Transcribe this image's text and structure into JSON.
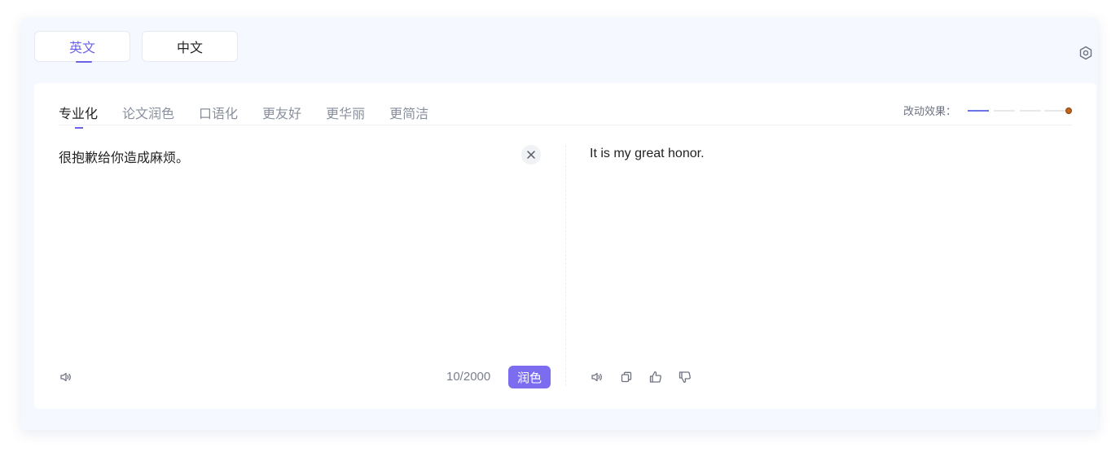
{
  "lang_tabs": [
    {
      "label": "英文",
      "active": true
    },
    {
      "label": "中文",
      "active": false
    }
  ],
  "icons": {
    "settings": "gear-icon",
    "clear": "close-icon",
    "speaker": "speaker-icon",
    "copy": "copy-icon",
    "like": "thumbs-up-icon",
    "dislike": "thumbs-down-icon"
  },
  "style_tabs": [
    {
      "label": "专业化",
      "active": true
    },
    {
      "label": "论文润色",
      "active": false
    },
    {
      "label": "口语化",
      "active": false
    },
    {
      "label": "更友好",
      "active": false
    },
    {
      "label": "更华丽",
      "active": false
    },
    {
      "label": "更简洁",
      "active": false
    }
  ],
  "effect": {
    "label": "改动效果：",
    "level": 1.0
  },
  "source": {
    "text": "很抱歉给你造成麻烦。",
    "counter": "10/2000"
  },
  "polish_button": "润色",
  "output": {
    "text": "It is my great honor."
  },
  "colors": {
    "accent": "#6a63e8",
    "button": "#7b6cf0",
    "panel_bg": "#f5f8ff"
  }
}
